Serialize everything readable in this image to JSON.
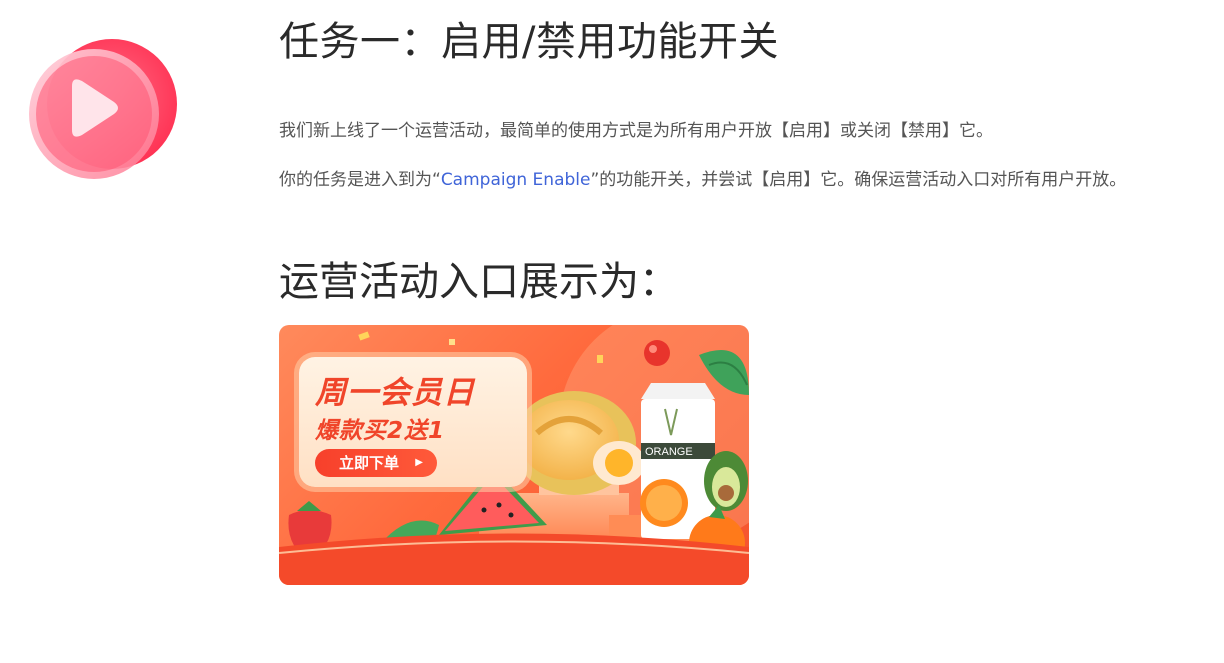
{
  "task": {
    "title": "任务一：启用/禁用功能开关",
    "para1": "我们新上线了一个运营活动，最简单的使用方式是为所有用户开放【启用】或关闭【禁用】它。",
    "para2_prefix": "你的任务是进入到为“",
    "para2_link": "Campaign Enable",
    "para2_suffix": "”的功能开关，并尝试【启用】它。确保运营活动入口对所有用户开放。"
  },
  "section": {
    "title": "运营活动入口展示为："
  },
  "banner": {
    "title": "周一会员日",
    "subtitle": "爆款买2送1",
    "button_label": "立即下单",
    "button_icon": "chevron-right-icon",
    "carton_label": "ORANGE"
  },
  "colors": {
    "link": "#3f64d8",
    "logo_primary": "#ff3d5a",
    "banner_accent": "#f0452a"
  },
  "icons": {
    "logo": "play-logo-icon"
  }
}
